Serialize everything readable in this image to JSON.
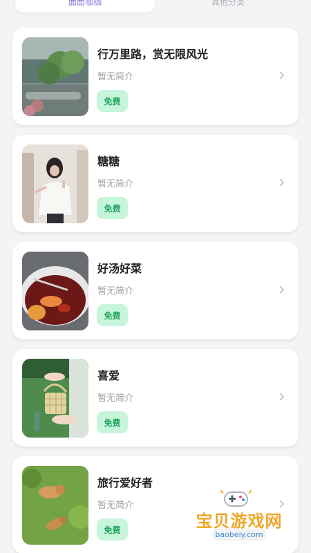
{
  "tabs": [
    {
      "label": "面面咖咖",
      "active": true
    },
    {
      "label": "其他分类",
      "active": false
    }
  ],
  "items": [
    {
      "title": "行万里路，赏无限风光",
      "description": "暂无简介",
      "badge": "免费",
      "thumb_icon": "mountain-photo"
    },
    {
      "title": "糖糖",
      "description": "暂无简介",
      "badge": "免费",
      "thumb_icon": "portrait-photo"
    },
    {
      "title": "好汤好菜",
      "description": "暂无简介",
      "badge": "免费",
      "thumb_icon": "soup-photo"
    },
    {
      "title": "喜爱",
      "description": "暂无简介",
      "badge": "免费",
      "thumb_icon": "basket-photo"
    },
    {
      "title": "旅行爱好者",
      "description": "暂无简介",
      "badge": "免费",
      "thumb_icon": "field-photo"
    }
  ],
  "watermark": {
    "text": "宝贝游戏网",
    "url": "baobeiy.com"
  },
  "colors": {
    "background": "#f4f4f7",
    "badge_bg": "#c7f5dc",
    "badge_text": "#20a45d",
    "watermark_text": "#f0a62a"
  }
}
